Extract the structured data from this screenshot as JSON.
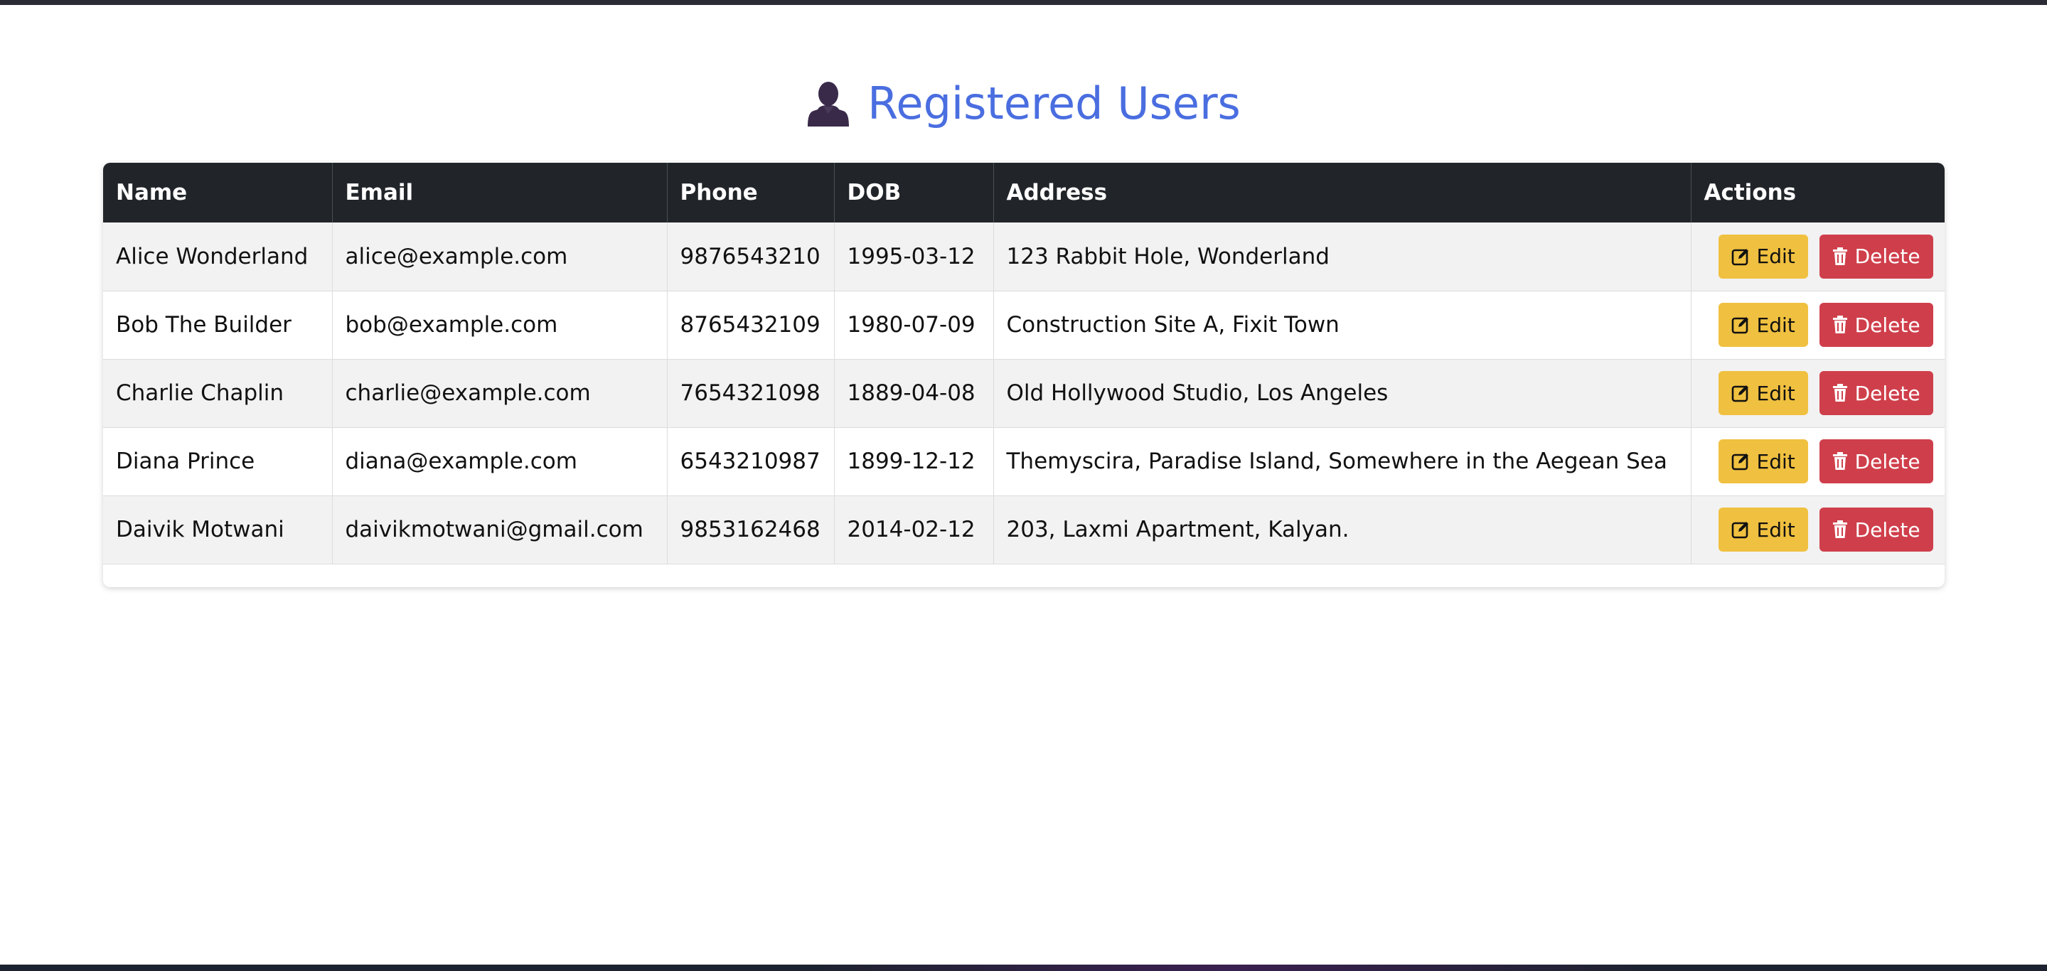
{
  "page": {
    "title": "Registered Users",
    "title_icon": "user-silhouette-icon",
    "title_color": "#4a6ee0"
  },
  "table": {
    "columns": [
      "Name",
      "Email",
      "Phone",
      "DOB",
      "Address",
      "Actions"
    ],
    "header_bg": "#212529",
    "rows": [
      {
        "name": "Alice Wonderland",
        "email": "alice@example.com",
        "phone": "9876543210",
        "dob": "1995-03-12",
        "address": "123 Rabbit Hole, Wonderland"
      },
      {
        "name": "Bob The Builder",
        "email": "bob@example.com",
        "phone": "8765432109",
        "dob": "1980-07-09",
        "address": "Construction Site A, Fixit Town"
      },
      {
        "name": "Charlie Chaplin",
        "email": "charlie@example.com",
        "phone": "7654321098",
        "dob": "1889-04-08",
        "address": "Old Hollywood Studio, Los Angeles"
      },
      {
        "name": "Diana Prince",
        "email": "diana@example.com",
        "phone": "6543210987",
        "dob": "1899-12-12",
        "address": "Themyscira, Paradise Island, Somewhere in the Aegean Sea"
      },
      {
        "name": "Daivik Motwani",
        "email": "daivikmotwani@gmail.com",
        "phone": "9853162468",
        "dob": "2014-02-12",
        "address": "203, Laxmi Apartment, Kalyan."
      }
    ]
  },
  "actions": {
    "edit_label": "Edit",
    "edit_icon": "edit-icon",
    "edit_color": "#f0c040",
    "delete_label": "Delete",
    "delete_icon": "trash-icon",
    "delete_color": "#cf3f4b"
  }
}
